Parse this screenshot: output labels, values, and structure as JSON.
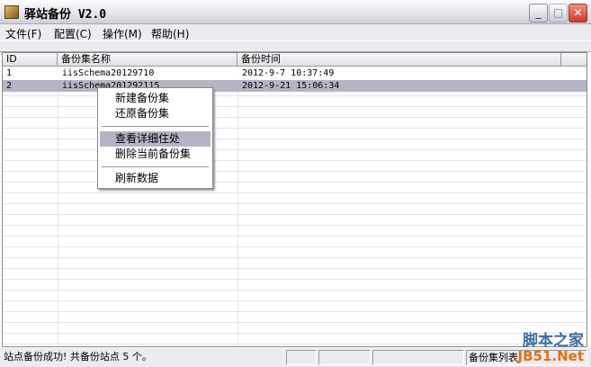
{
  "window": {
    "title": "驿站备份 V2.0",
    "minimize": "_",
    "maximize": "□",
    "close": "✕"
  },
  "menu": [
    "文件(F)",
    "配置(C)",
    "操作(M)",
    "帮助(H)"
  ],
  "table": {
    "columns": [
      "ID",
      "备份集名称",
      "备份时间"
    ],
    "rows": [
      {
        "id": "1",
        "name": "iisSchema20129710",
        "time": "2012-9-7 10:37:49"
      },
      {
        "id": "2",
        "name": "iisSchema201292115",
        "time": "2012-9-21 15:06:34"
      }
    ]
  },
  "context_menu": [
    "新建备份集",
    "还原备份集",
    "查看详细住处",
    "删除当前备份集",
    "刷新数据"
  ],
  "status": {
    "message": "站点备份成功! 共备份站点 5 个。",
    "pane2": "",
    "pane3": "",
    "pane4": "备份集列表"
  },
  "watermark": {
    "line1": "脚本之家",
    "line2": "JB51.Net"
  }
}
